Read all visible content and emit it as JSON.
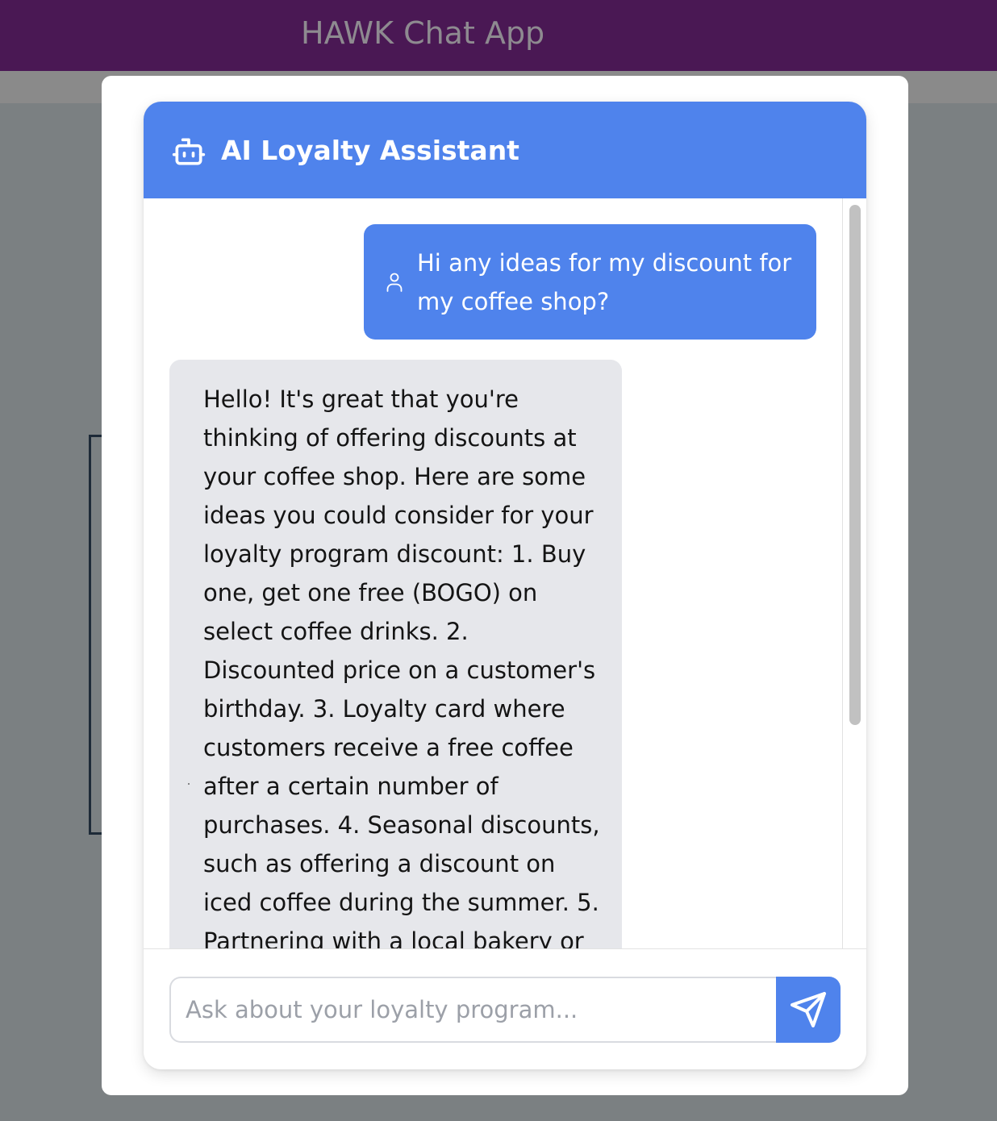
{
  "app": {
    "title": "HAWK Chat App"
  },
  "chat": {
    "header_title": "AI Loyalty Assistant",
    "header_icon": "robot-icon",
    "messages": [
      {
        "role": "user",
        "icon": "user-icon",
        "text": "Hi any ideas for my discount for my coffee shop?"
      },
      {
        "role": "assistant",
        "text": "Hello! It's great that you're thinking of offering discounts at your coffee shop. Here are some ideas you could consider for your loyalty program discount: 1. Buy one, get one free (BOGO) on select coffee drinks. 2. Discounted price on a customer's birthday. 3. Loyalty card where customers receive a free coffee after a certain number of purchases. 4. Seasonal discounts, such as offering a discount on iced coffee during the summer. 5. Partnering with a local bakery or"
      }
    ],
    "input": {
      "placeholder": "Ask about your loyalty program...",
      "value": ""
    },
    "send_icon": "send-icon"
  },
  "colors": {
    "topbar": "#4a1854",
    "accent": "#4f83ec",
    "assistant_bubble": "#e6e7eb",
    "overlay": "#7b8082"
  }
}
